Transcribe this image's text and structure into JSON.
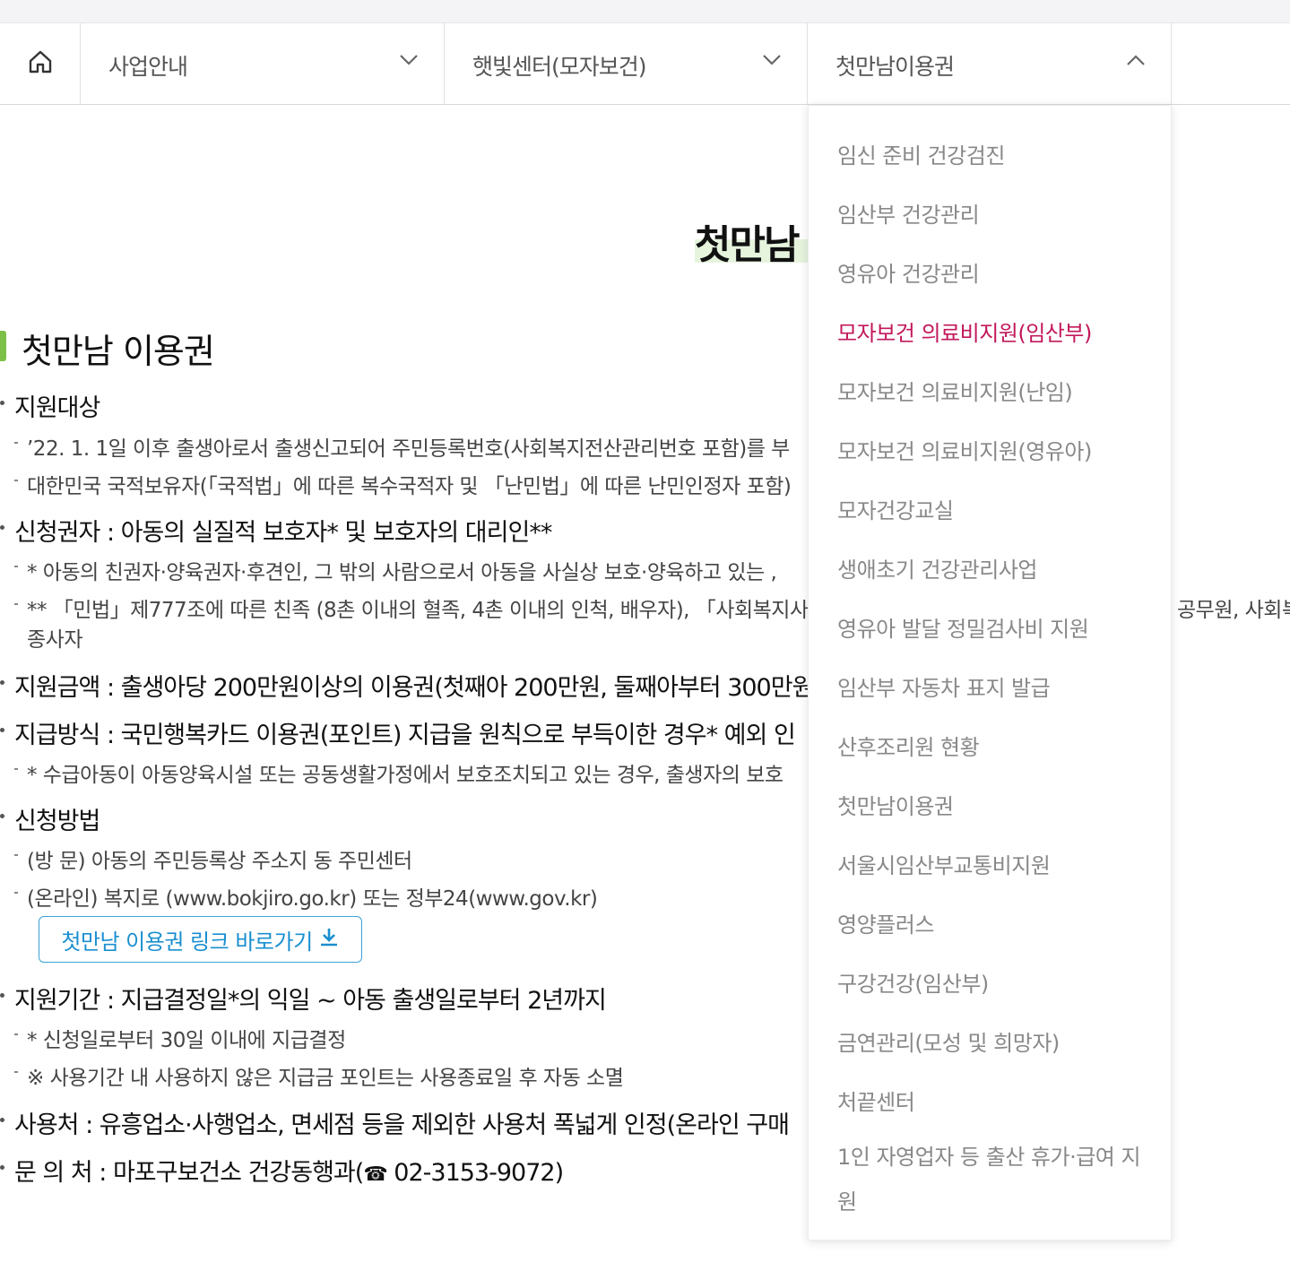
{
  "nav": {
    "home_icon": "home-icon",
    "menu1": {
      "label": "사업안내",
      "icon": "chevron-down-icon"
    },
    "menu2": {
      "label": "햇빛센터(모자보건)",
      "icon": "chevron-down-icon"
    },
    "menu3": {
      "label": "첫만남이용권",
      "icon": "chevron-up-icon"
    }
  },
  "page": {
    "title": "첫만남",
    "section_title": "첫만남 이용권",
    "items": {
      "target_heading": "지원대상",
      "target_1": "’22. 1. 1일 이후 출생아로서 출생신고되어 주민등록번호(사회복지전산관리번호 포함)를 부",
      "target_2": "대한민국 국적보유자(「국적법」에 따른 복수국적자 및 「난민법」에 따른 난민인정자 포함)",
      "applicant_heading": "신청권자 : 아동의 실질적 보호자* 및 보호자의 대리인**",
      "applicant_1": "* 아동의 친권자·양육권자·후견인, 그 밖의 사람으로서 아동을 사실상 보호·양육하고 있는 ,",
      "applicant_2a": "** 「민법」제777조에 따른 친족 (8촌 이내의 혈족, 4촌 이내의 인척, 배우자), 「사회복지사업",
      "applicant_2a_tail": "공무원, 사회복",
      "applicant_2b": "종사자",
      "amount": "지원금액 : 출생아당 200만원이상의 이용권(첫째아 200만원, 둘째아부터 300만원",
      "method": "지급방식 : 국민행복카드 이용권(포인트) 지급을 원칙으로 부득이한 경우* 예외 인",
      "method_1": "* 수급아동이 아동양육시설 또는 공동생활가정에서 보호조치되고 있는 경우, 출생자의 보호",
      "apply_heading": "신청방법",
      "apply_1": "(방 문) 아동의 주민등록상 주소지 동 주민센터",
      "apply_2": "(온라인) 복지로 (www.bokjiro.go.kr) 또는 정부24(www.gov.kr)",
      "period": "지원기간 : 지급결정일*의 익일 ~ 아동 출생일로부터 2년까지",
      "period_1": "* 신청일로부터 30일 이내에 지급결정",
      "period_2": "※ 사용기간 내 사용하지 않은 지급금 포인트는 사용종료일 후 자동 소멸",
      "usage": "사용처 : 유흥업소·사행업소, 면세점 등을 제외한 사용처 폭넓게 인정(온라인 구매",
      "contact_prefix": "문 의 처 : 마포구보건소 건강동행과(",
      "contact_phone_icon": "phone-icon",
      "contact_number": " 02-3153-9072)"
    },
    "link_button": {
      "label": "첫만남 이용권 링크 바로가기",
      "icon": "download-icon"
    }
  },
  "dropdown": {
    "items": [
      "임신 준비 건강검진",
      "임산부 건강관리",
      "영유아 건강관리",
      "모자보건 의료비지원(임산부)",
      "모자보건 의료비지원(난임)",
      "모자보건 의료비지원(영유아)",
      "모자건강교실",
      "생애초기 건강관리사업",
      "영유아 발달 정밀검사비 지원",
      "임산부 자동차 표지 발급",
      "산후조리원 현황",
      "첫만남이용권",
      "서울시임산부교통비지원",
      "영양플러스",
      "구강건강(임산부)",
      "금연관리(모성 및 희망자)",
      "처끝센터",
      "1인 자영업자 등 출산 휴가·급여 지원"
    ],
    "active_index": 3,
    "active_color": "#c2185b"
  }
}
